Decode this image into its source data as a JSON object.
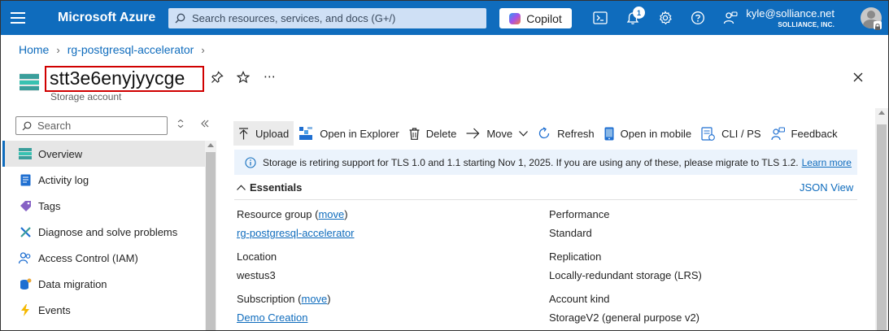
{
  "topbar": {
    "brand": "Microsoft Azure",
    "search_placeholder": "Search resources, services, and docs (G+/)",
    "copilot_label": "Copilot",
    "notification_count": "1",
    "user_email": "kyle@solliance.net",
    "user_tenant": "SOLLIANCE, INC.",
    "icons": [
      "hamburger-menu-icon",
      "cloud-shell-icon",
      "notifications-bell-icon",
      "settings-gear-icon",
      "help-question-icon",
      "feedback-person-icon"
    ]
  },
  "breadcrumb": {
    "items": [
      "Home",
      "rg-postgresql-accelerator"
    ]
  },
  "resource": {
    "name": "stt3e6enyjyycge",
    "type": "Storage account"
  },
  "nav": {
    "search_placeholder": "Search",
    "items": [
      {
        "label": "Overview",
        "icon": "overview-icon",
        "active": true
      },
      {
        "label": "Activity log",
        "icon": "activity-log-icon"
      },
      {
        "label": "Tags",
        "icon": "tag-icon"
      },
      {
        "label": "Diagnose and solve problems",
        "icon": "wrench-icon"
      },
      {
        "label": "Access Control (IAM)",
        "icon": "people-icon"
      },
      {
        "label": "Data migration",
        "icon": "data-migration-icon"
      },
      {
        "label": "Events",
        "icon": "lightning-icon"
      }
    ]
  },
  "commands": {
    "upload": "Upload",
    "open_in_explorer": "Open in Explorer",
    "delete": "Delete",
    "move": "Move",
    "refresh": "Refresh",
    "open_in_mobile": "Open in mobile",
    "cli_ps": "CLI / PS",
    "feedback": "Feedback"
  },
  "banner": {
    "text": "Storage is retiring support for TLS 1.0 and 1.1 starting Nov 1, 2025. If you are using any of these, please migrate to TLS 1.2.",
    "link": "Learn more"
  },
  "essentials": {
    "title": "Essentials",
    "json_view": "JSON View",
    "resource_group_label": "Resource group",
    "move_link": "move",
    "resource_group_value": "rg-postgresql-accelerator",
    "location_label": "Location",
    "location_value": "westus3",
    "subscription_label": "Subscription",
    "subscription_value": "Demo Creation",
    "performance_label": "Performance",
    "performance_value": "Standard",
    "replication_label": "Replication",
    "replication_value": "Locally-redundant storage (LRS)",
    "account_kind_label": "Account kind",
    "account_kind_value": "StorageV2 (general purpose v2)"
  },
  "colors": {
    "azure_blue": "#0f6cbd",
    "banner_bg": "#ebf3fc",
    "highlight_border": "#d00000"
  }
}
